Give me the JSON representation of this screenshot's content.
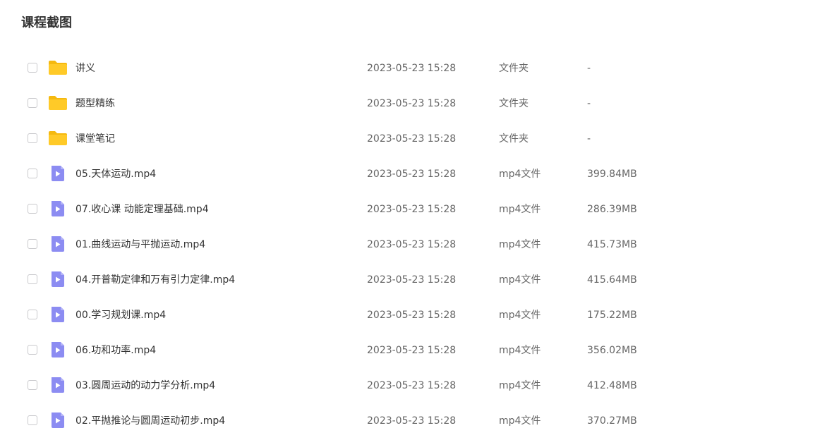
{
  "page": {
    "title": "课程截图"
  },
  "files": [
    {
      "name": "讲义",
      "time": "2023-05-23 15:28",
      "type": "文件夹",
      "size": "-",
      "icon": "folder-icon"
    },
    {
      "name": "题型精练",
      "time": "2023-05-23 15:28",
      "type": "文件夹",
      "size": "-",
      "icon": "folder-icon"
    },
    {
      "name": "课堂笔记",
      "time": "2023-05-23 15:28",
      "type": "文件夹",
      "size": "-",
      "icon": "folder-icon"
    },
    {
      "name": "05.天体运动.mp4",
      "time": "2023-05-23 15:28",
      "type": "mp4文件",
      "size": "399.84MB",
      "icon": "video-file-icon"
    },
    {
      "name": "07.收心课 动能定理基础.mp4",
      "time": "2023-05-23 15:28",
      "type": "mp4文件",
      "size": "286.39MB",
      "icon": "video-file-icon"
    },
    {
      "name": "01.曲线运动与平抛运动.mp4",
      "time": "2023-05-23 15:28",
      "type": "mp4文件",
      "size": "415.73MB",
      "icon": "video-file-icon"
    },
    {
      "name": "04.开普勒定律和万有引力定律.mp4",
      "time": "2023-05-23 15:28",
      "type": "mp4文件",
      "size": "415.64MB",
      "icon": "video-file-icon"
    },
    {
      "name": "00.学习规划课.mp4",
      "time": "2023-05-23 15:28",
      "type": "mp4文件",
      "size": "175.22MB",
      "icon": "video-file-icon"
    },
    {
      "name": "06.功和功率.mp4",
      "time": "2023-05-23 15:28",
      "type": "mp4文件",
      "size": "356.02MB",
      "icon": "video-file-icon"
    },
    {
      "name": "03.圆周运动的动力学分析.mp4",
      "time": "2023-05-23 15:28",
      "type": "mp4文件",
      "size": "412.48MB",
      "icon": "video-file-icon"
    },
    {
      "name": "02.平抛推论与圆周运动初步.mp4",
      "time": "2023-05-23 15:28",
      "type": "mp4文件",
      "size": "370.27MB",
      "icon": "video-file-icon"
    }
  ],
  "colors": {
    "folder": "#FFCA28",
    "folder_tab": "#F5B90F",
    "video_icon": "#8C8CF2",
    "video_play": "#FFFFFF",
    "checkbox_border": "#C9C9CC"
  }
}
